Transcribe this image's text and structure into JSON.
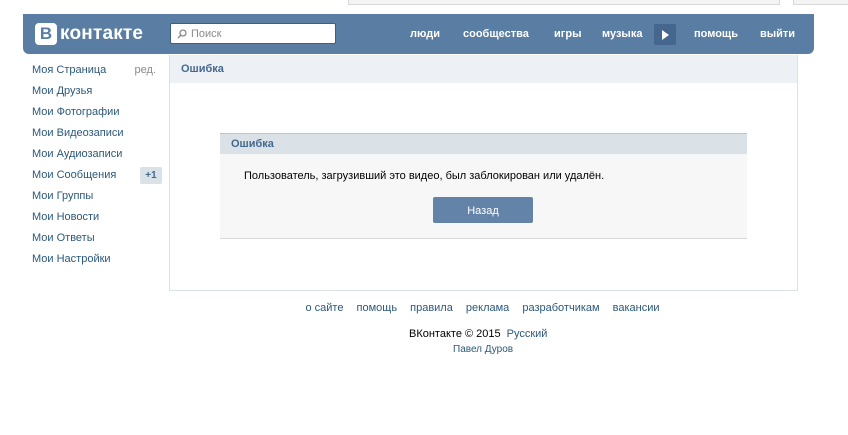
{
  "header": {
    "logo_mark": "B",
    "logo_text": "контакте",
    "search_placeholder": "Поиск",
    "nav": [
      "люди",
      "сообщества",
      "игры",
      "музыка",
      "помощь",
      "выйти"
    ],
    "brand_color": "#597da3"
  },
  "sidebar": {
    "items": [
      {
        "label": "Моя Страница",
        "extra": "ред."
      },
      {
        "label": "Мои Друзья"
      },
      {
        "label": "Мои Фотографии"
      },
      {
        "label": "Мои Видеозаписи"
      },
      {
        "label": "Мои Аудиозаписи"
      },
      {
        "label": "Мои Сообщения",
        "badge": "+1"
      },
      {
        "label": "Мои Группы"
      },
      {
        "label": "Мои Новости"
      },
      {
        "label": "Мои Ответы"
      },
      {
        "label": "Мои Настройки"
      }
    ]
  },
  "main": {
    "title": "Ошибка",
    "error": {
      "title": "Ошибка",
      "message": "Пользователь, загрузивший это видео, был заблокирован или удалён.",
      "back_label": "Назад"
    }
  },
  "footer": {
    "links": [
      "о сайте",
      "помощь",
      "правила",
      "реклама",
      "разработчикам",
      "вакансии"
    ],
    "copyright": "ВКонтакте © 2015",
    "language": "Русский",
    "author": "Павел Дуров"
  }
}
